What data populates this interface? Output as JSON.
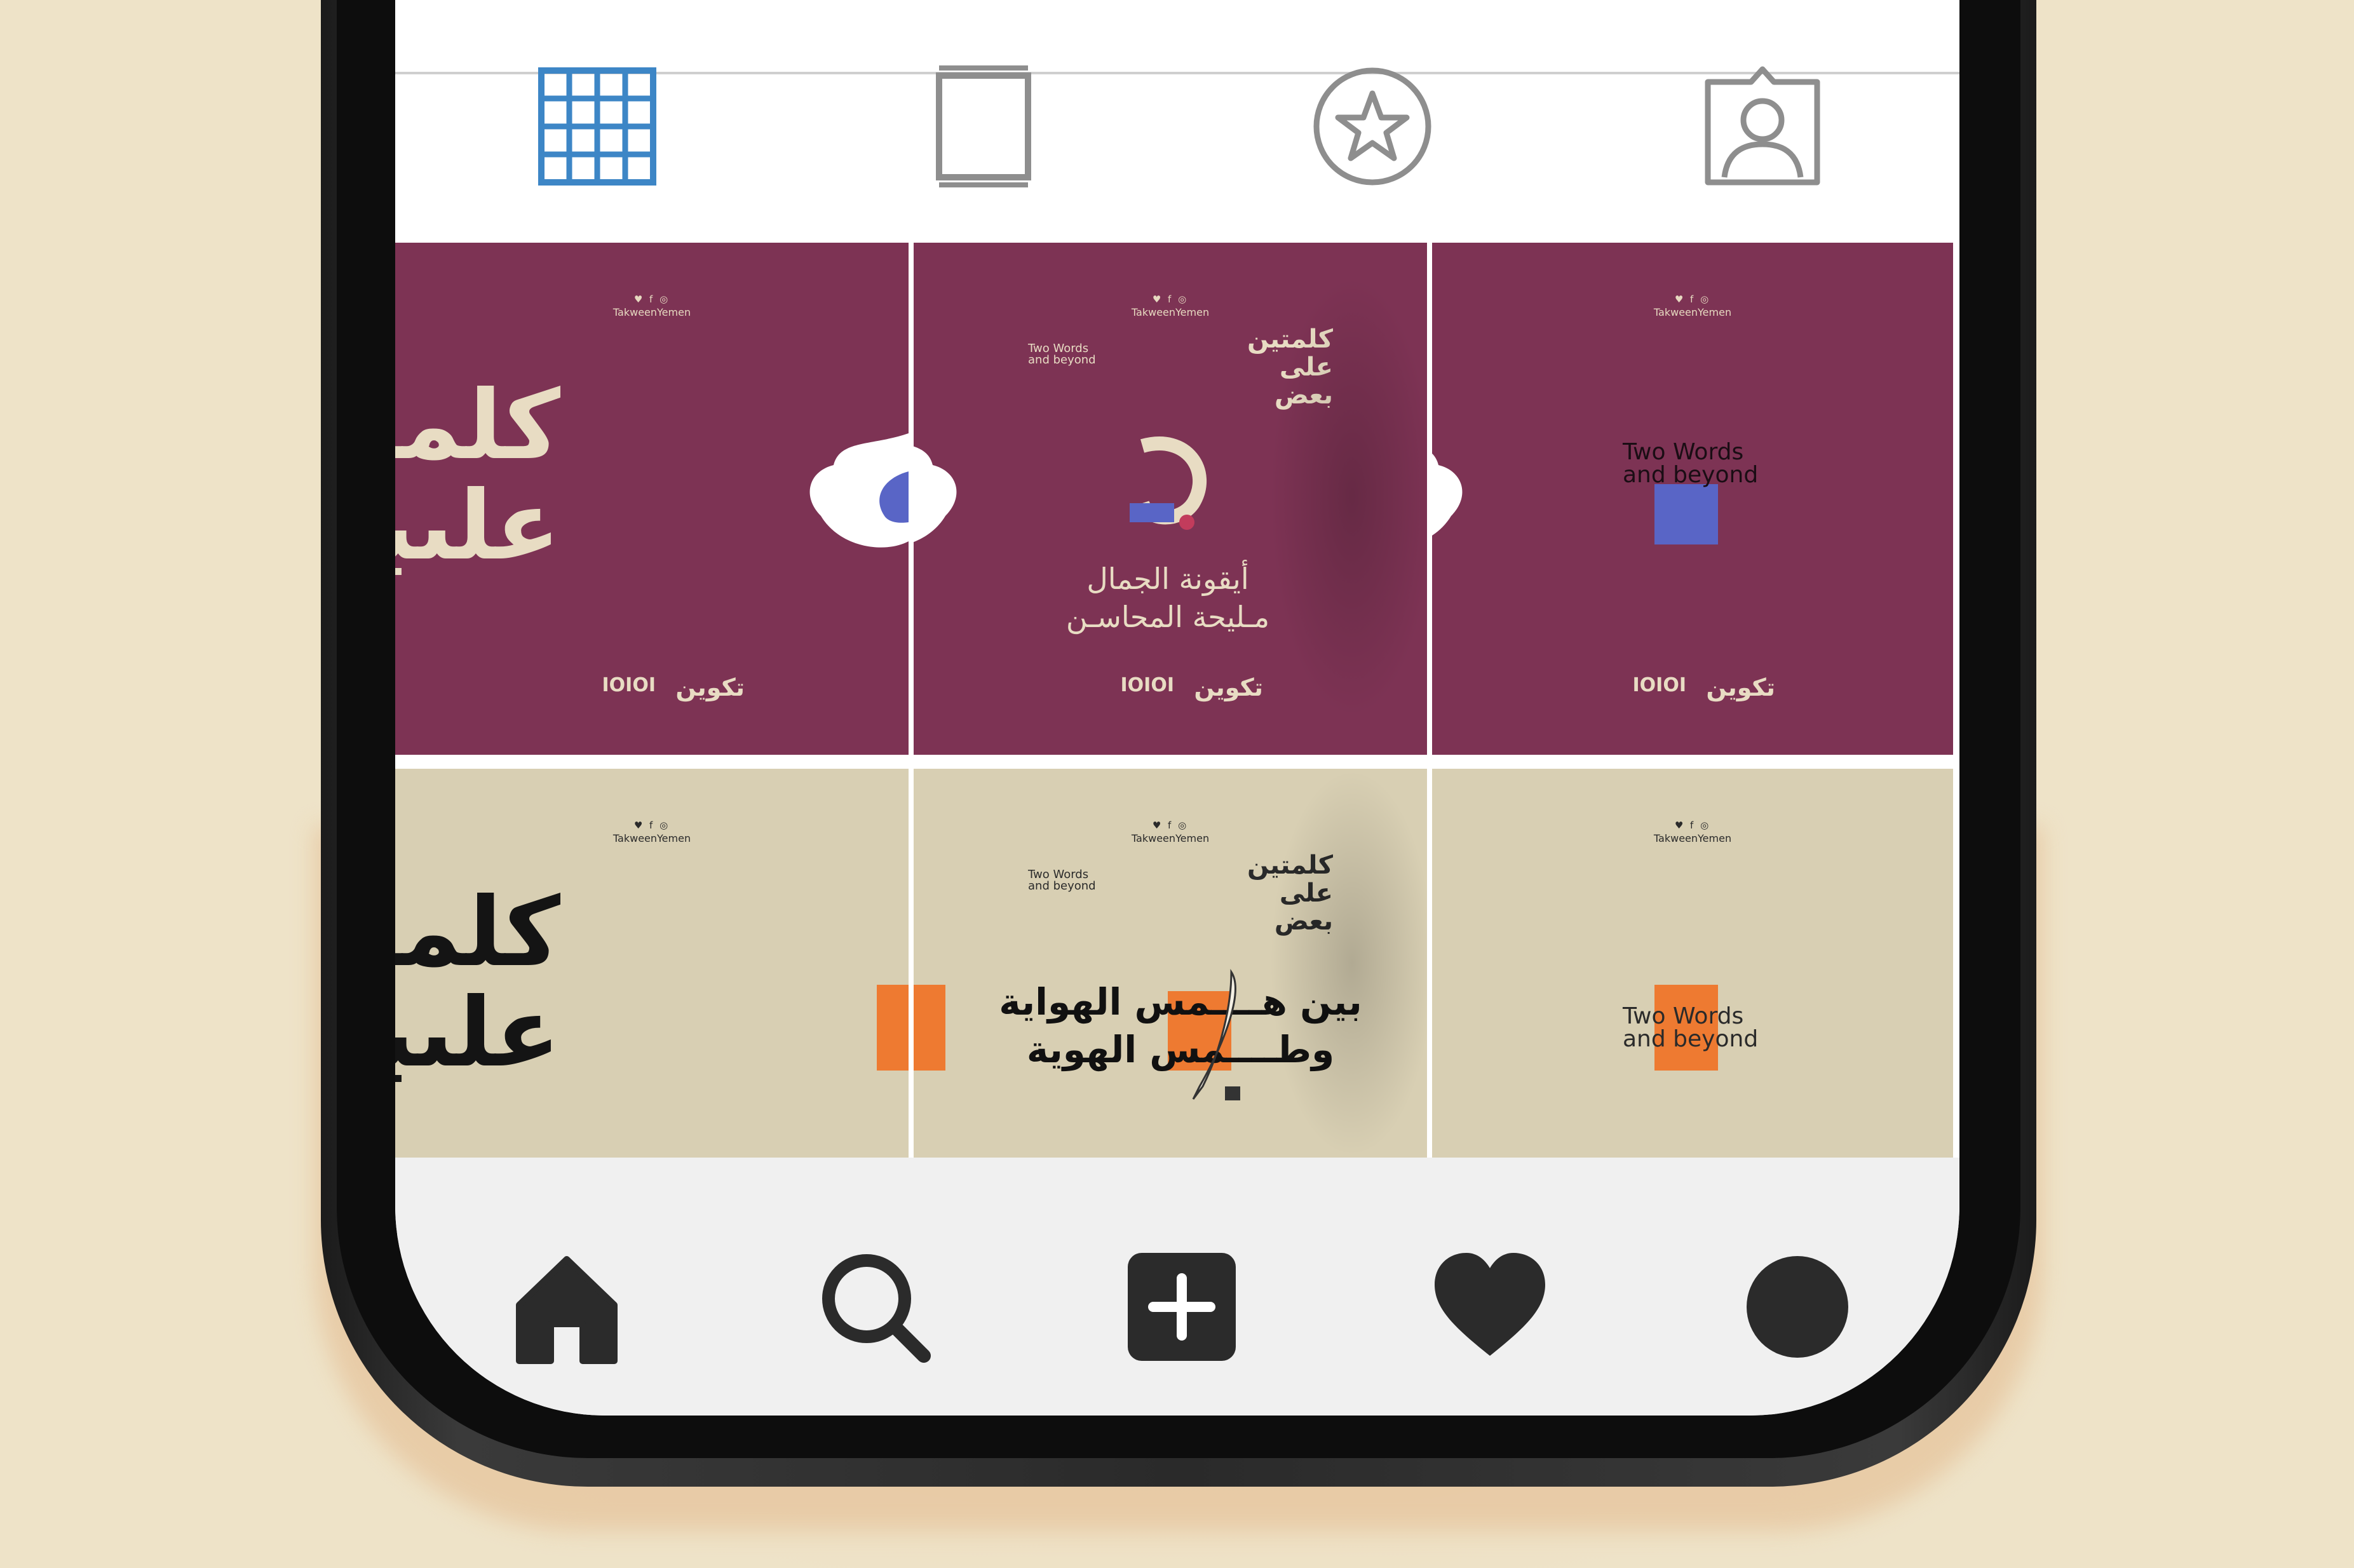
{
  "colors": {
    "background": "#EEE3C8",
    "plum": "#7D3354",
    "sand": "#D8CFB3",
    "cream_text": "#E8DCC3",
    "orange_accent": "#EE7A31",
    "violet_accent": "#5965C6",
    "active_tab": "#3D86C6",
    "inactive_tab": "#8E8E8E",
    "nav_icon": "#2B2B2B"
  },
  "profile_tabs": [
    {
      "name": "grid-view",
      "icon": "grid-icon",
      "active": true
    },
    {
      "name": "igtv",
      "icon": "tv-frame-icon",
      "active": false
    },
    {
      "name": "featured",
      "icon": "star-circle-icon",
      "active": false
    },
    {
      "name": "tagged",
      "icon": "tagged-person-icon",
      "active": false
    }
  ],
  "posts": {
    "handle": "TakweenYemen",
    "social_glyphs": "♥ f ◎",
    "title_ar_line1": "كلمـ",
    "title_ar_line2": "علىبعـ",
    "small_title_ar_line1": "كلمتين",
    "small_title_ar_line2": "على بعض",
    "title_en_line1": "Two Words",
    "title_en_line2": "and beyond",
    "plum_caption_line1": "أيقونة الجمال",
    "plum_caption_line2": "مـليحة المحاسـن",
    "sand_caption_line1": "بين هــــمس الهواية",
    "sand_caption_line2": "وطــــمس الهوية",
    "logo_mark": "IOIOI",
    "logo_takween": "تكوين"
  },
  "bottom_nav": [
    {
      "name": "home",
      "icon": "home-icon"
    },
    {
      "name": "search",
      "icon": "search-icon"
    },
    {
      "name": "new-post",
      "icon": "plus-square-icon"
    },
    {
      "name": "activity",
      "icon": "heart-icon"
    },
    {
      "name": "profile",
      "icon": "profile-avatar-icon"
    }
  ]
}
